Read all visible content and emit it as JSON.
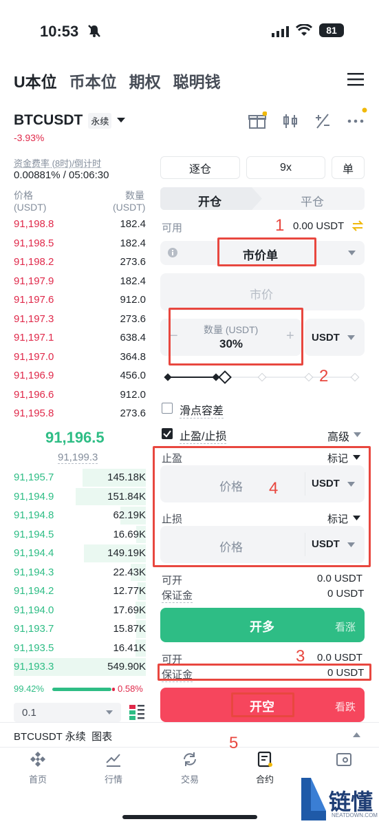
{
  "status_bar": {
    "time": "10:53",
    "battery": "81"
  },
  "top_tabs": [
    "U本位",
    "币本位",
    "期权",
    "聪明钱"
  ],
  "symbol": {
    "name": "BTCUSDT",
    "type": "永续",
    "change": "-3.93%"
  },
  "funding": {
    "label": "资金费率 (8时)/倒计时",
    "value": "0.00881% / 05:06:30"
  },
  "orderbook": {
    "price_header": "价格",
    "price_unit": "(USDT)",
    "qty_header": "数量",
    "qty_unit": "(USDT)",
    "asks": [
      {
        "price": "91,198.8",
        "qty": "182.4"
      },
      {
        "price": "91,198.5",
        "qty": "182.4"
      },
      {
        "price": "91,198.2",
        "qty": "273.6"
      },
      {
        "price": "91,197.9",
        "qty": "182.4"
      },
      {
        "price": "91,197.6",
        "qty": "912.0"
      },
      {
        "price": "91,197.3",
        "qty": "273.6"
      },
      {
        "price": "91,197.1",
        "qty": "638.4"
      },
      {
        "price": "91,197.0",
        "qty": "364.8"
      },
      {
        "price": "91,196.9",
        "qty": "456.0"
      },
      {
        "price": "91,196.6",
        "qty": "912.0"
      },
      {
        "price": "91,195.8",
        "qty": "273.6"
      }
    ],
    "last_price": "91,196.5",
    "mark_price": "91,199.3",
    "bids": [
      {
        "price": "91,195.7",
        "qty": "145.18K"
      },
      {
        "price": "91,194.9",
        "qty": "151.84K"
      },
      {
        "price": "91,194.8",
        "qty": "62.19K"
      },
      {
        "price": "91,194.5",
        "qty": "16.69K"
      },
      {
        "price": "91,194.4",
        "qty": "149.19K"
      },
      {
        "price": "91,194.3",
        "qty": "22.43K"
      },
      {
        "price": "91,194.2",
        "qty": "12.77K"
      },
      {
        "price": "91,194.0",
        "qty": "17.69K"
      },
      {
        "price": "91,193.7",
        "qty": "15.87K"
      },
      {
        "price": "91,193.5",
        "qty": "16.41K"
      },
      {
        "price": "91,193.3",
        "qty": "549.90K"
      }
    ],
    "buy_ratio": "99.42%",
    "sell_ratio": "0.58%",
    "precision": "0.1"
  },
  "order_panel": {
    "margin_mode": "逐仓",
    "leverage": "9x",
    "position_mode": "单",
    "tab_open": "开仓",
    "tab_close": "平仓",
    "available_label": "可用",
    "available_value": "0.00 USDT",
    "order_type": "市价单",
    "price_placeholder": "市价",
    "qty_label": "数量 (USDT)",
    "qty_value": "30%",
    "qty_unit": "USDT",
    "slippage_label": "滑点容差",
    "tpsl_label": "止盈/止损",
    "advanced_label": "高级",
    "tp_label": "止盈",
    "sl_label": "止损",
    "mark_label": "标记",
    "price_placeholder2": "价格",
    "unit": "USDT",
    "long_max_label": "可开",
    "long_max_value": "0.0 USDT",
    "long_margin_label": "保证金",
    "long_margin_value": "0 USDT",
    "long_button": "开多",
    "long_hint": "看涨",
    "short_max_label": "可开",
    "short_max_value": "0.0 USDT",
    "short_margin_label": "保证金",
    "short_margin_value": "0 USDT",
    "short_button": "开空",
    "short_hint": "看跌"
  },
  "chart_bar": {
    "label": "BTCUSDT 永续  图表"
  },
  "bottom_nav": [
    "首页",
    "行情",
    "交易",
    "合约",
    ""
  ],
  "annotations": [
    "1",
    "2",
    "3",
    "4",
    "5"
  ],
  "watermark": {
    "text": "链懂",
    "sub": "NEATDOWN.COM"
  },
  "colors": {
    "red": "#e0294a",
    "green": "#2ebd85",
    "annot": "#e8473f"
  }
}
